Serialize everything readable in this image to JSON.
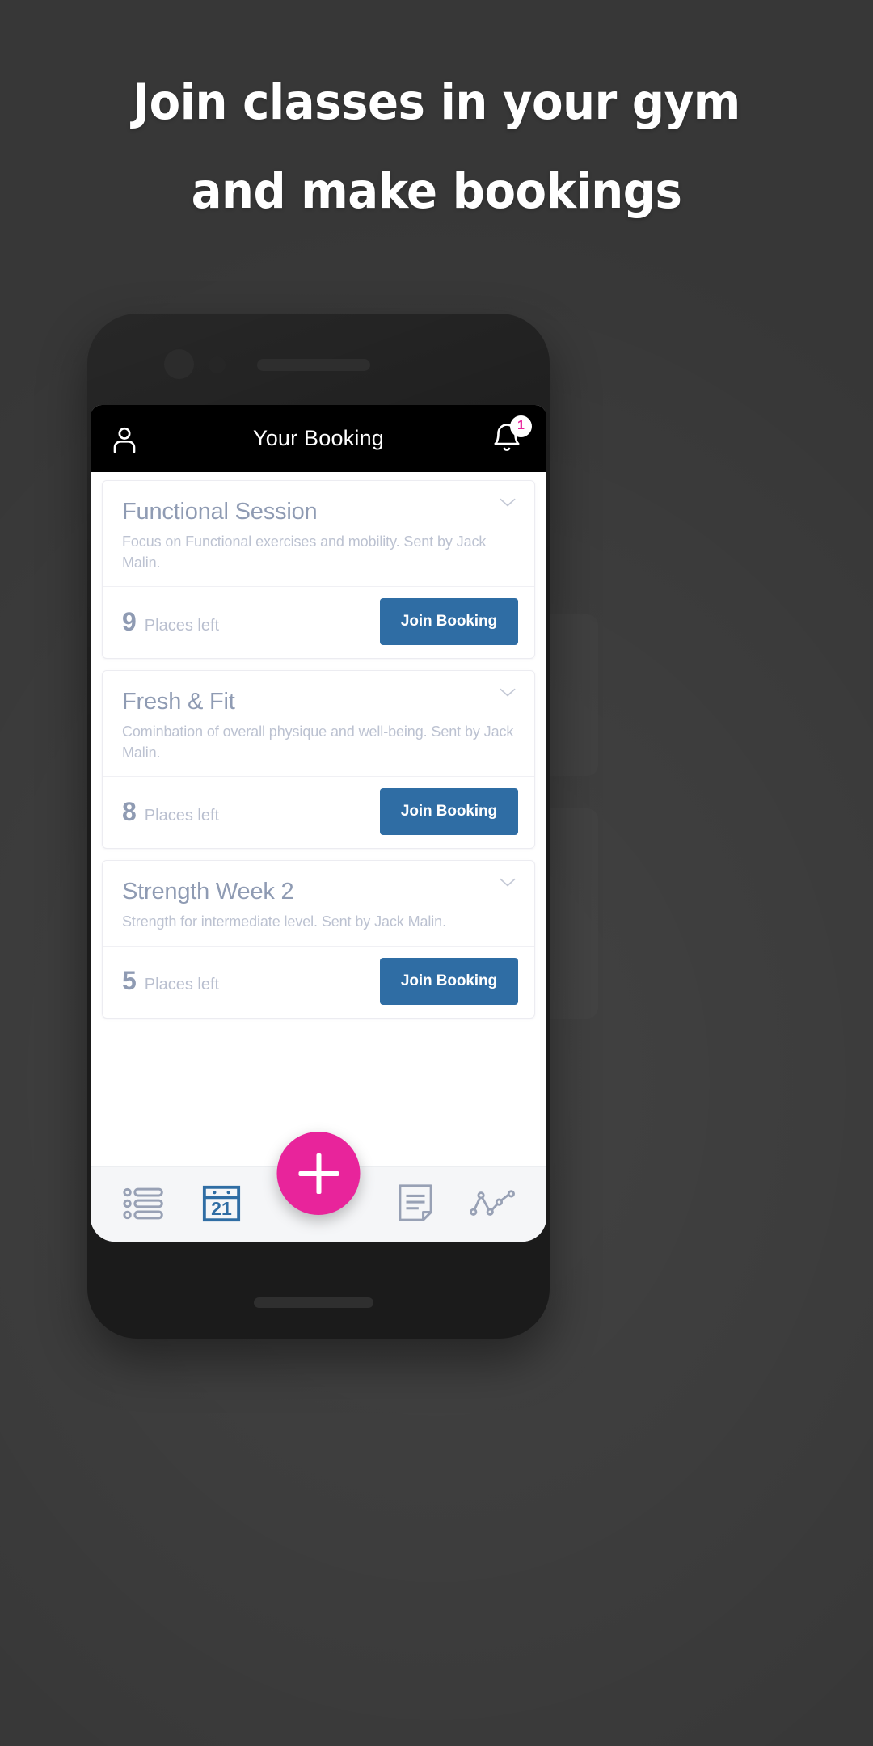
{
  "promo": {
    "headline_line1": "Join classes in your gym",
    "headline_line2": "and make bookings",
    "background_color": "#4a4a4a",
    "text_color": "#ffffff"
  },
  "app": {
    "header": {
      "title": "Your Booking",
      "profile_icon": "person-icon",
      "notification_icon": "bell-icon",
      "notification_count": "1",
      "badge_color": "#e8249b",
      "background_color": "#000000"
    },
    "bookings": [
      {
        "title": "Functional Session",
        "description": "Focus on Functional exercises and mobility. Sent by Jack Malin.",
        "places_count": "9",
        "places_label": "Places left",
        "action_label": "Join Booking",
        "expand_icon": "chevron-down-icon"
      },
      {
        "title": "Fresh & Fit",
        "description": "Cominbation of overall physique and well-being. Sent by Jack Malin.",
        "places_count": "8",
        "places_label": "Places left",
        "action_label": "Join Booking",
        "expand_icon": "chevron-down-icon"
      },
      {
        "title": "Strength Week 2",
        "description": "Strength for intermediate level. Sent by Jack Malin.",
        "places_count": "5",
        "places_label": "Places left",
        "action_label": "Join Booking",
        "expand_icon": "chevron-down-icon"
      }
    ],
    "bottom_nav": {
      "items": [
        {
          "icon": "list-icon"
        },
        {
          "icon": "calendar-icon",
          "day": "21"
        },
        {
          "icon": "note-icon"
        },
        {
          "icon": "analytics-icon"
        }
      ],
      "fab_icon": "plus-icon",
      "fab_color": "#e8249b",
      "background_color": "#f5f6f8"
    },
    "accent_color": "#2f6da4",
    "muted_text_color": "#8f9bb3"
  }
}
